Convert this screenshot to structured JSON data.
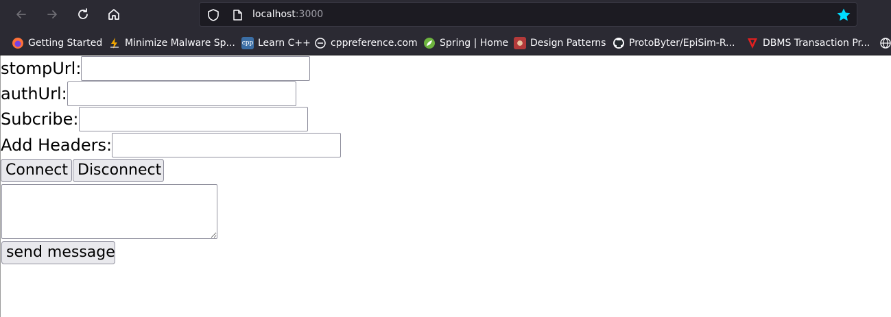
{
  "browser": {
    "url_host": "localhost",
    "url_port": ":3000",
    "icons": {
      "back": "arrow-left-icon",
      "forward": "arrow-right-icon",
      "reload": "reload-icon",
      "home": "home-icon",
      "shield": "shield-icon",
      "page": "page-icon",
      "bookmark_star": "star-icon"
    },
    "accent": "#00ddff"
  },
  "bookmarks": [
    {
      "label": "Getting Started",
      "icon": "firefox-icon",
      "color": "#ff7139"
    },
    {
      "label": "Minimize Malware Sp...",
      "icon": "lightning-icon",
      "color": "#f0a500"
    },
    {
      "label": "Learn C++",
      "icon": "cpp-icon",
      "color": "#3b6ea5"
    },
    {
      "label": "cppreference.com",
      "icon": "cppreference-icon",
      "color": "#555555"
    },
    {
      "label": "Spring | Home",
      "icon": "spring-leaf-icon",
      "color": "#6db33f"
    },
    {
      "label": "Design Patterns",
      "icon": "design-patterns-icon",
      "color": "#b33a3a"
    },
    {
      "label": "ProtoByter/EpiSim-R...",
      "icon": "github-icon",
      "color": "#24292e"
    },
    {
      "label": "DBMS Transaction Pr...",
      "icon": "triangle-icon",
      "color": "#e02020"
    }
  ],
  "form": {
    "stomp_label": "stompUrl:",
    "stomp_value": "",
    "auth_label": "authUrl:",
    "auth_value": "",
    "subscribe_label": "Subcribe:",
    "subscribe_value": "",
    "headers_label": "Add Headers:",
    "headers_value": "",
    "connect_label": "Connect",
    "disconnect_label": "Disconnect",
    "message_value": "",
    "send_label": "send message"
  }
}
